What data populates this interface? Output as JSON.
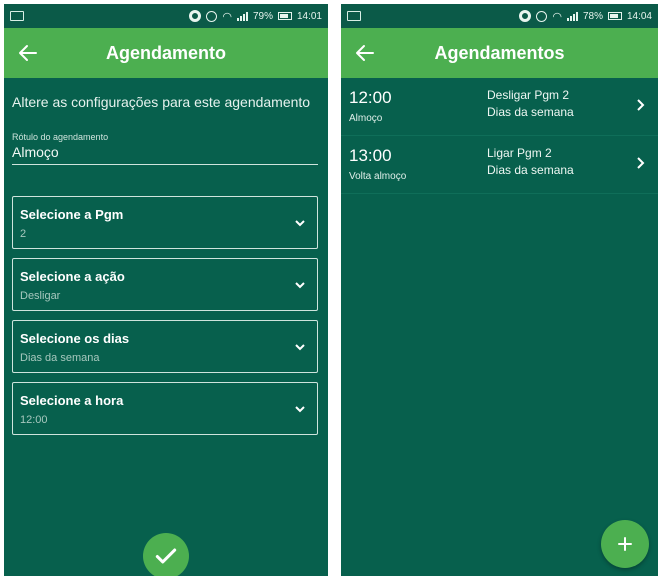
{
  "colors": {
    "background": "#07604d",
    "appbar": "#4caf50",
    "fab": "#4caf50"
  },
  "left_screen": {
    "status": {
      "battery": "79%",
      "time": "14:01"
    },
    "title": "Agendamento",
    "intro": "Altere as configurações para este agendamento",
    "label_field": {
      "label": "Rótulo do agendamento",
      "value": "Almoço"
    },
    "selects": [
      {
        "title": "Selecione a Pgm",
        "value": "2"
      },
      {
        "title": "Selecione a ação",
        "value": "Desligar"
      },
      {
        "title": "Selecione os dias",
        "value": "Dias da semana"
      },
      {
        "title": "Selecione a hora",
        "value": "12:00"
      }
    ],
    "confirm_icon": "check-icon"
  },
  "right_screen": {
    "status": {
      "battery": "78%",
      "time": "14:04"
    },
    "title": "Agendamentos",
    "items": [
      {
        "time": "12:00",
        "label": "Almoço",
        "action": "Desligar Pgm 2",
        "days": "Dias da semana"
      },
      {
        "time": "13:00",
        "label": "Volta almoço",
        "action": "Ligar Pgm 2",
        "days": "Dias da semana"
      }
    ],
    "add_icon": "plus-icon"
  }
}
